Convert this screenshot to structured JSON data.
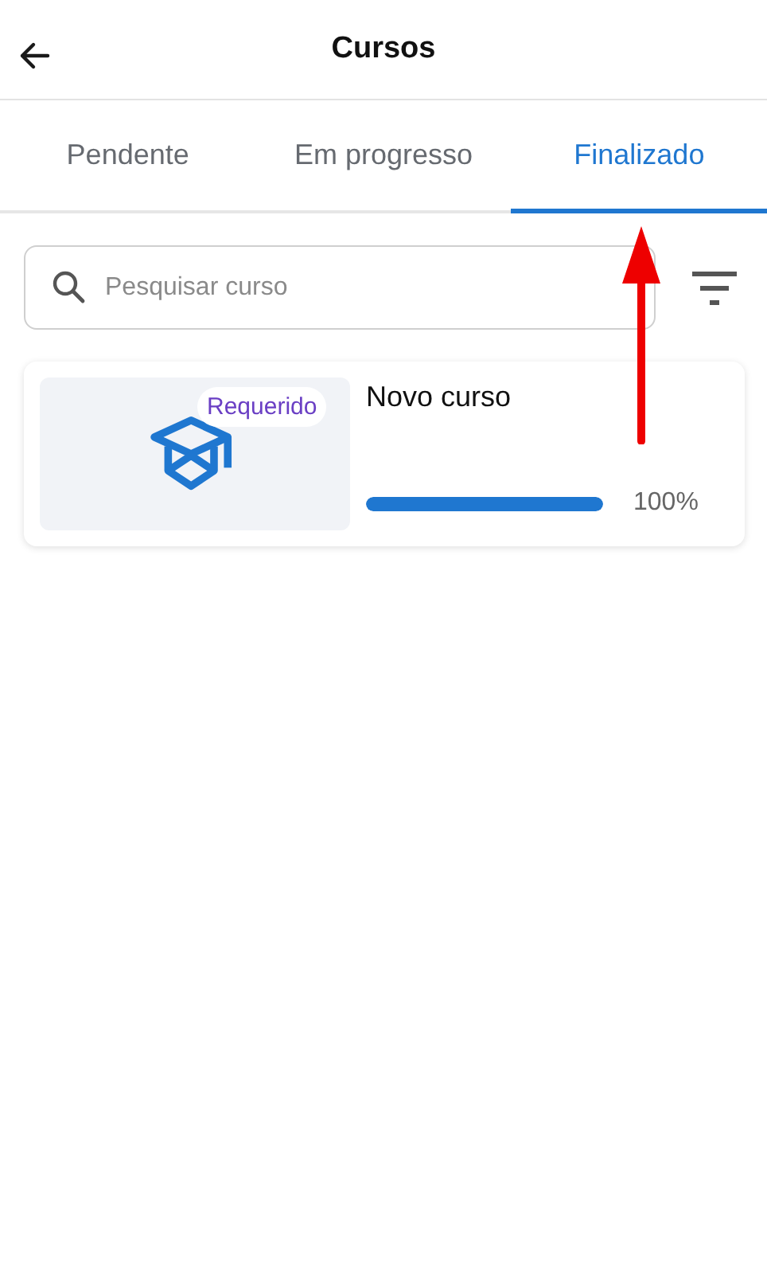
{
  "header": {
    "title": "Cursos"
  },
  "tabs": [
    {
      "label": "Pendente",
      "selected": false
    },
    {
      "label": "Em progresso",
      "selected": false
    },
    {
      "label": "Finalizado",
      "selected": true
    }
  ],
  "search": {
    "placeholder": "Pesquisar curso"
  },
  "courses": [
    {
      "title": "Novo curso",
      "badge": "Requerido",
      "level": 1,
      "reading": "100%"
    }
  ]
}
